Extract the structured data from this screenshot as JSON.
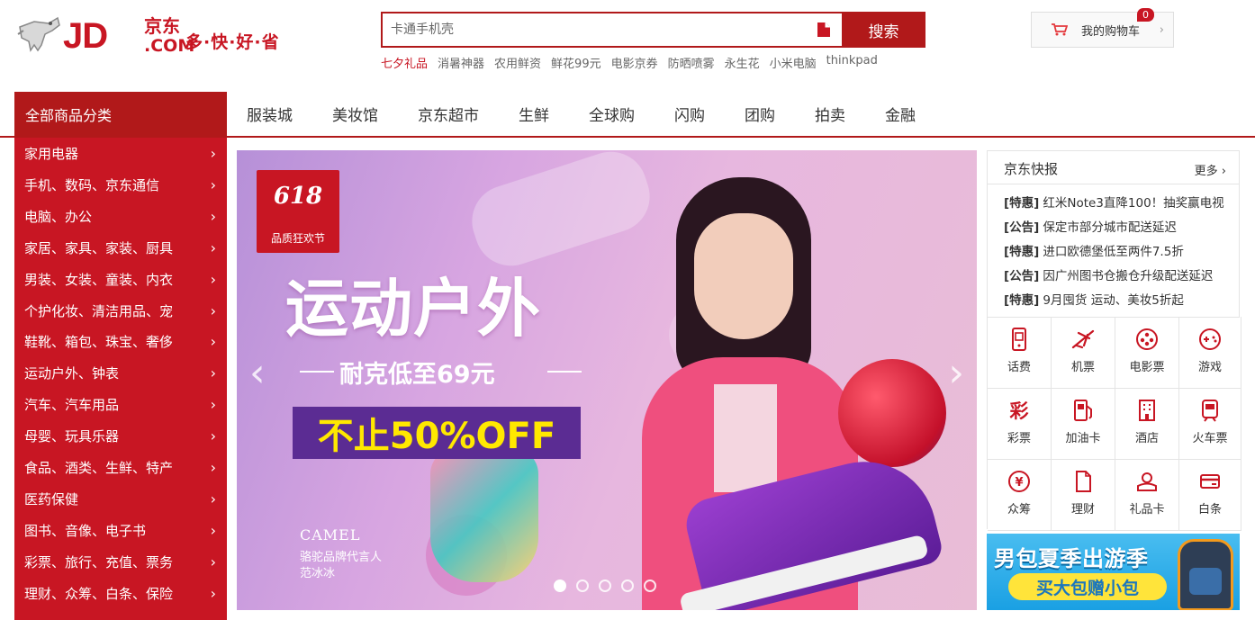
{
  "header": {
    "logo_text": "JD",
    "logo_cn": "京东",
    "logo_com": ".COM",
    "slogan": "多·快·好·省",
    "search_placeholder": "卡通手机壳",
    "search_button": "搜索",
    "cart_label": "我的购物车",
    "cart_count": "0",
    "hotwords": [
      {
        "label": "七夕礼品",
        "hot": true
      },
      {
        "label": "消暑神器",
        "hot": false
      },
      {
        "label": "农用鲜资",
        "hot": false
      },
      {
        "label": "鲜花99元",
        "hot": false
      },
      {
        "label": "电影京券",
        "hot": false
      },
      {
        "label": "防晒喷雾",
        "hot": false
      },
      {
        "label": "永生花",
        "hot": false
      },
      {
        "label": "小米电脑",
        "hot": false
      },
      {
        "label": "thinkpad",
        "hot": false
      }
    ]
  },
  "nav": {
    "all_categories": "全部商品分类",
    "links": [
      "服装城",
      "美妆馆",
      "京东超市",
      "生鲜",
      "全球购",
      "闪购",
      "团购",
      "拍卖",
      "金融"
    ]
  },
  "categories": [
    "家用电器",
    "手机、数码、京东通信",
    "电脑、办公",
    "家居、家具、家装、厨具",
    "男装、女装、童装、内衣",
    "个护化妆、清洁用品、宠",
    "鞋靴、箱包、珠宝、奢侈",
    "运动户外、钟表",
    "汽车、汽车用品",
    "母婴、玩具乐器",
    "食品、酒类、生鲜、特产",
    "医药保健",
    "图书、音像、电子书",
    "彩票、旅行、充值、票务",
    "理财、众筹、白条、保险"
  ],
  "banner": {
    "badge_number": "618",
    "badge_text": "品质狂欢节",
    "title": "运动户外",
    "subtitle": "耐克低至69元",
    "offer": "不止50%OFF",
    "brand": "CAMEL",
    "brand_line1": "骆驼品牌代言人",
    "brand_line2": "范冰冰",
    "slide_count": 5,
    "active_slide": 1
  },
  "news": {
    "title": "京东快报",
    "more": "更多",
    "items": [
      {
        "tag": "[特惠]",
        "text": "红米Note3直降100！抽奖赢电视"
      },
      {
        "tag": "[公告]",
        "text": "保定市部分城市配送延迟"
      },
      {
        "tag": "[特惠]",
        "text": "进口欧德堡低至两件7.5折"
      },
      {
        "tag": "[公告]",
        "text": "因广州图书仓搬仓升级配送延迟"
      },
      {
        "tag": "[特惠]",
        "text": "9月囤货 运动、美妆5折起"
      }
    ]
  },
  "services": [
    {
      "label": "话费",
      "icon": "phone-bill-icon"
    },
    {
      "label": "机票",
      "icon": "airplane-icon"
    },
    {
      "label": "电影票",
      "icon": "film-reel-icon"
    },
    {
      "label": "游戏",
      "icon": "gamepad-icon"
    },
    {
      "label": "彩票",
      "icon": "lottery-icon"
    },
    {
      "label": "加油卡",
      "icon": "fuel-pump-icon"
    },
    {
      "label": "酒店",
      "icon": "hotel-icon"
    },
    {
      "label": "火车票",
      "icon": "train-icon"
    },
    {
      "label": "众筹",
      "icon": "yuan-coin-icon"
    },
    {
      "label": "理财",
      "icon": "document-icon"
    },
    {
      "label": "礼品卡",
      "icon": "gift-card-icon"
    },
    {
      "label": "白条",
      "icon": "credit-card-icon"
    }
  ],
  "ad": {
    "title": "男包夏季出游季",
    "subtitle": "买大包赠小包"
  },
  "colors": {
    "brand_red": "#c81623",
    "dark_red": "#b1191a"
  }
}
